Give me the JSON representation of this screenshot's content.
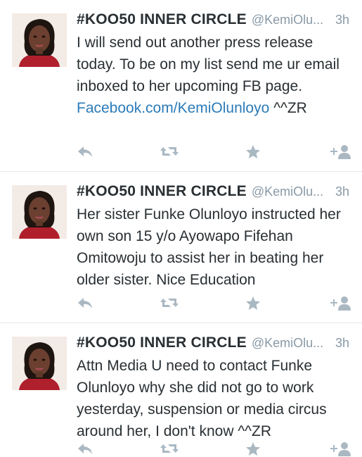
{
  "colors": {
    "text": "#292f33",
    "meta": "#8899a6",
    "link": "#2b7bb9",
    "action_icon": "#aab8c2",
    "divider": "#e1e8ed"
  },
  "tweets": [
    {
      "name": "#KOO50 INNER CIRCLE",
      "handle": "@KemiOlu...",
      "time": "3h",
      "text_before": "I will send out another press release today. To be on my list send me ur email inboxed to her upcoming FB page. ",
      "link": "Facebook.com/KemiOlunloyo",
      "text_after": " ^^ZR"
    },
    {
      "name": "#KOO50 INNER CIRCLE",
      "handle": "@KemiOlu...",
      "time": "3h",
      "text_before": "Her sister Funke Olunloyo instructed her own son 15 y/o Ayowapo Fifehan Omitowoju to assist her in beating her older  sister. Nice Education",
      "link": "",
      "text_after": ""
    },
    {
      "name": "#KOO50 INNER CIRCLE",
      "handle": "@KemiOlu...",
      "time": "3h",
      "text_before": "Attn Media U need to contact Funke Olunloyo why she did not go to work yesterday, suspension or media circus around her, I don't know ^^ZR",
      "link": "",
      "text_after": ""
    }
  ],
  "actions": {
    "reply_icon": "reply-icon",
    "retweet_icon": "retweet-icon",
    "favorite_icon": "star-icon",
    "follow_icon": "add-user-icon"
  }
}
